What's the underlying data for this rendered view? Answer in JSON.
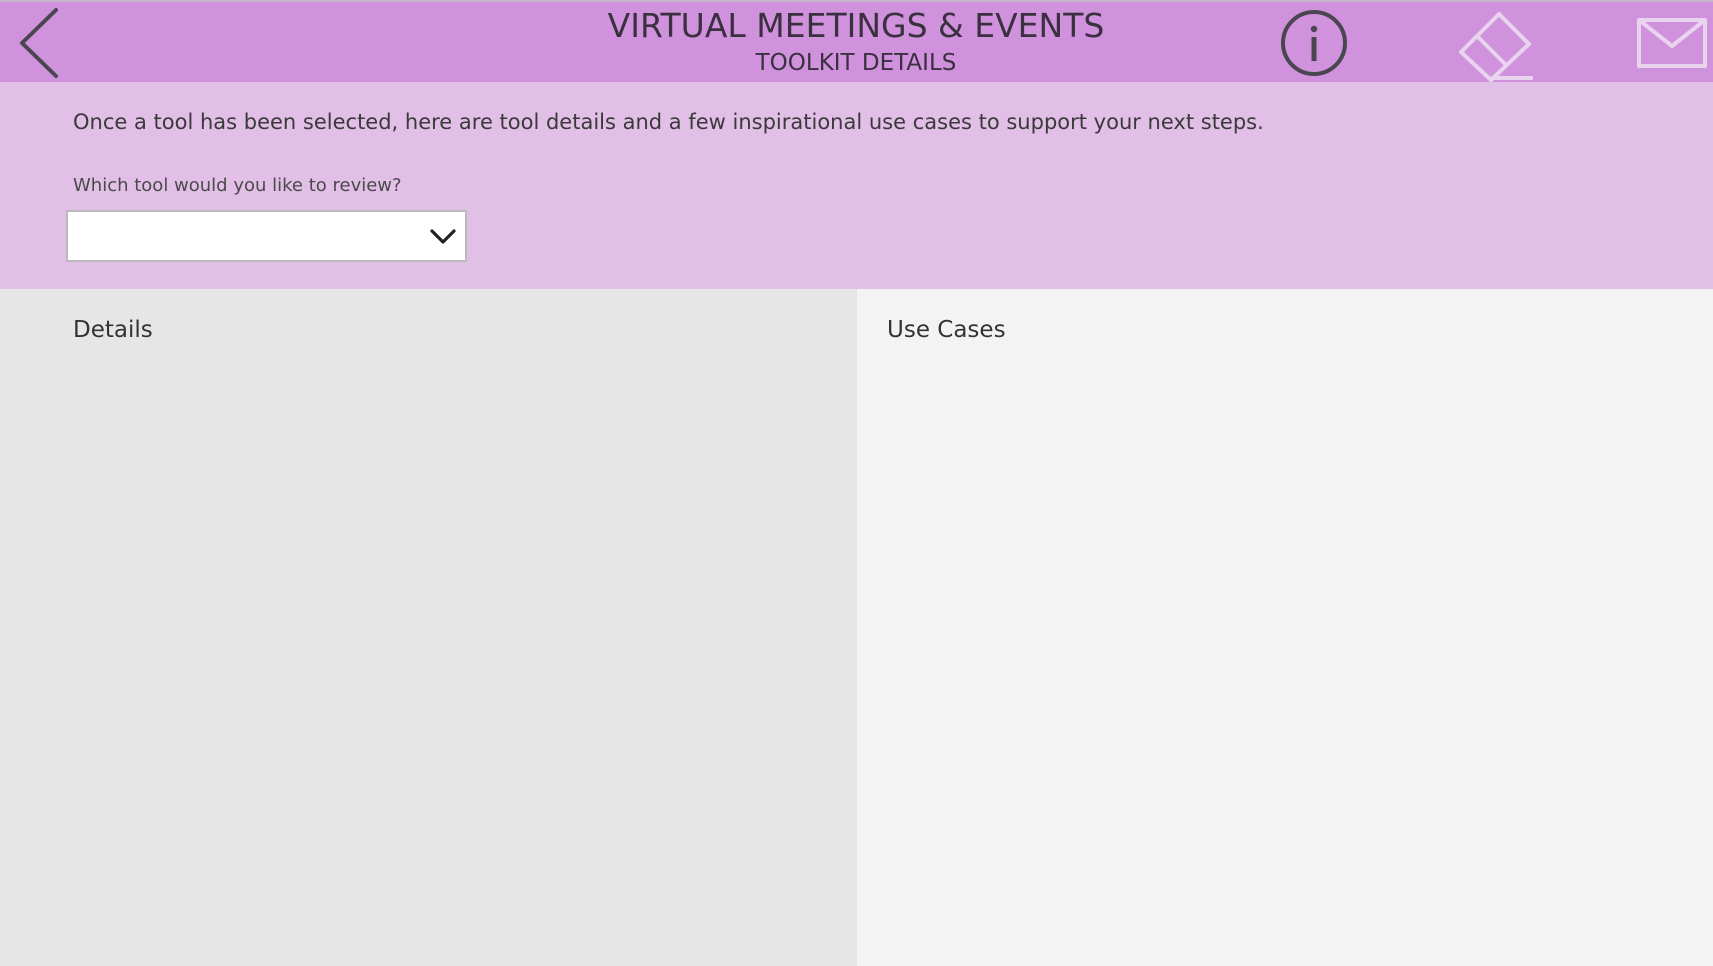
{
  "header": {
    "title": "VIRTUAL MEETINGS & EVENTS",
    "subtitle": "TOOLKIT DETAILS",
    "icons": [
      "chevron-left-icon",
      "info-icon",
      "eraser-icon",
      "mail-icon"
    ],
    "background_color": "#d092dd"
  },
  "intro": {
    "text": "Once a tool has been selected, here are tool details and a few inspirational use cases to support your next steps.",
    "question": "Which tool would you like to review?",
    "background_color": "#e2bfe7"
  },
  "tool_select": {
    "selected": ""
  },
  "panels": {
    "details_heading": "Details",
    "use_cases_heading": "Use Cases"
  }
}
